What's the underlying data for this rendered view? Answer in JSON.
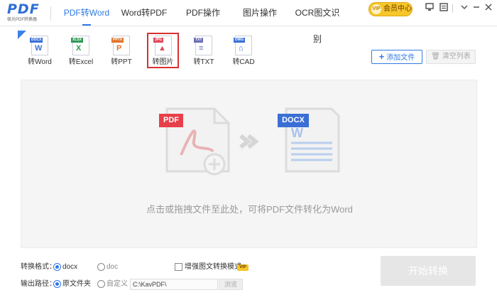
{
  "app": {
    "logo_text": "PDF",
    "logo_sub": "极光PDF转换器"
  },
  "nav": {
    "tabs": [
      {
        "label": "PDF转Word",
        "active": true
      },
      {
        "label": "Word转PDF",
        "active": false
      },
      {
        "label": "PDF操作",
        "active": false
      },
      {
        "label": "图片操作",
        "active": false
      },
      {
        "label": "OCR图文识别",
        "active": false
      }
    ],
    "vip_label": "会员中心",
    "vip_badge": "VIP"
  },
  "window_controls": {
    "icons": [
      "monitor-icon",
      "message-icon",
      "dropdown-icon",
      "minimize-icon",
      "close-icon"
    ]
  },
  "tools": [
    {
      "label": "转Word",
      "tag": "DOCX",
      "tag_color": "#3b6fd6",
      "glyph": "W",
      "glyph_color": "#3b6fd6"
    },
    {
      "label": "转Excel",
      "tag": "XLSX",
      "tag_color": "#2e9a55",
      "glyph": "X",
      "glyph_color": "#2e9a55"
    },
    {
      "label": "转PPT",
      "tag": "PPTX",
      "tag_color": "#e0742b",
      "glyph": "P",
      "glyph_color": "#e0742b"
    },
    {
      "label": "转图片",
      "tag": "JPG",
      "tag_color": "#e04a5a",
      "glyph": "▲",
      "glyph_color": "#e04a5a"
    },
    {
      "label": "转TXT",
      "tag": "TXT",
      "tag_color": "#6b6fb5",
      "glyph": "≡",
      "glyph_color": "#6b6fb5"
    },
    {
      "label": "转CAD",
      "tag": "DWG",
      "tag_color": "#3b6fd6",
      "glyph": "⌂",
      "glyph_color": "#3b6fd6"
    }
  ],
  "toolbar": {
    "add_file": "添加文件",
    "clear_list": "清空列表"
  },
  "drop_area": {
    "source_badge": "PDF",
    "target_badge": "DOCX",
    "hint": "点击或拖拽文件至此处，可将PDF文件转化为Word"
  },
  "options": {
    "format_label": "转换格式：",
    "format_docx": "docx",
    "format_doc": "doc",
    "enhance_label": "增强图文转换模式",
    "enhance_badge": "VIP",
    "output_label": "输出路径：",
    "output_original": "原文件夹",
    "output_custom": "自定义",
    "path_value": "C:\\KavPDF\\",
    "browse_label": "浏览",
    "start_label": "开始转换"
  },
  "colors": {
    "accent": "#2f7ae5",
    "pdf_red": "#e8404a",
    "docx_blue": "#3b6fd6"
  }
}
